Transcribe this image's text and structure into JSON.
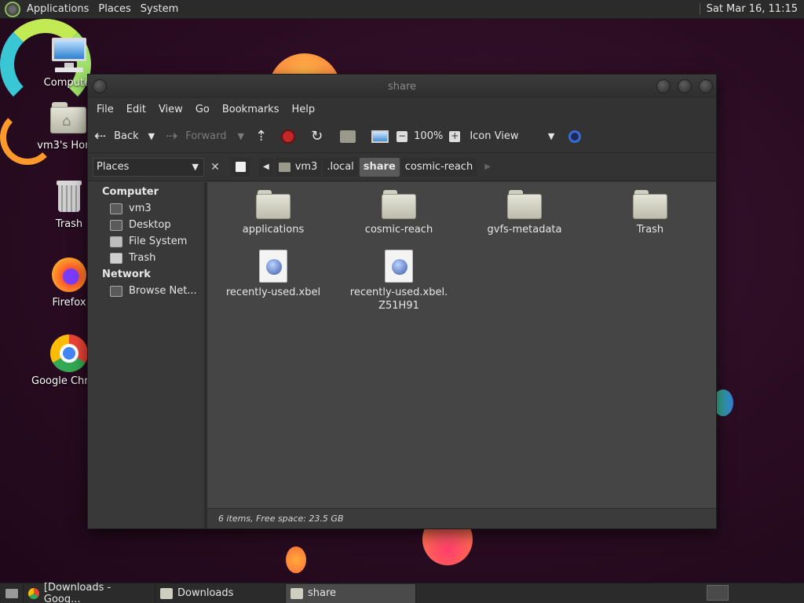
{
  "top_panel": {
    "menus": [
      "Applications",
      "Places",
      "System"
    ],
    "clock": "Sat Mar 16, 11:15"
  },
  "desktop_icons": [
    {
      "label": "Computer",
      "icon": "computer-icon"
    },
    {
      "label": "vm3's Home",
      "icon": "home-folder-icon"
    },
    {
      "label": "Trash",
      "icon": "trash-icon"
    },
    {
      "label": "Firefox",
      "icon": "firefox-icon"
    },
    {
      "label": "Google Chrome",
      "icon": "chrome-icon"
    }
  ],
  "window": {
    "title": "share",
    "menu": [
      "File",
      "Edit",
      "View",
      "Go",
      "Bookmarks",
      "Help"
    ],
    "toolbar": {
      "back": "Back",
      "forward": "Forward",
      "zoom": "100%",
      "view_mode": "Icon View"
    },
    "location": {
      "places": "Places",
      "crumbs": [
        "vm3",
        ".local",
        "share",
        "cosmic-reach"
      ],
      "active_crumb": "share"
    },
    "sidebar": {
      "sections": [
        {
          "heading": "Computer",
          "items": [
            "vm3",
            "Desktop",
            "File System",
            "Trash"
          ]
        },
        {
          "heading": "Network",
          "items": [
            "Browse Net..."
          ]
        }
      ]
    },
    "files": [
      {
        "name": "applications",
        "type": "folder"
      },
      {
        "name": "cosmic-reach",
        "type": "folder"
      },
      {
        "name": "gvfs-metadata",
        "type": "folder"
      },
      {
        "name": "Trash",
        "type": "folder"
      },
      {
        "name": "recently-used.xbel",
        "type": "xbel"
      },
      {
        "name": "recently-used.xbel.\nZ51H91",
        "type": "xbel"
      }
    ],
    "status": "6 items, Free space: 23.5 GB"
  },
  "taskbar": {
    "tasks": [
      "[Downloads - Goog...",
      "Downloads",
      "share"
    ],
    "active_task": "share"
  }
}
